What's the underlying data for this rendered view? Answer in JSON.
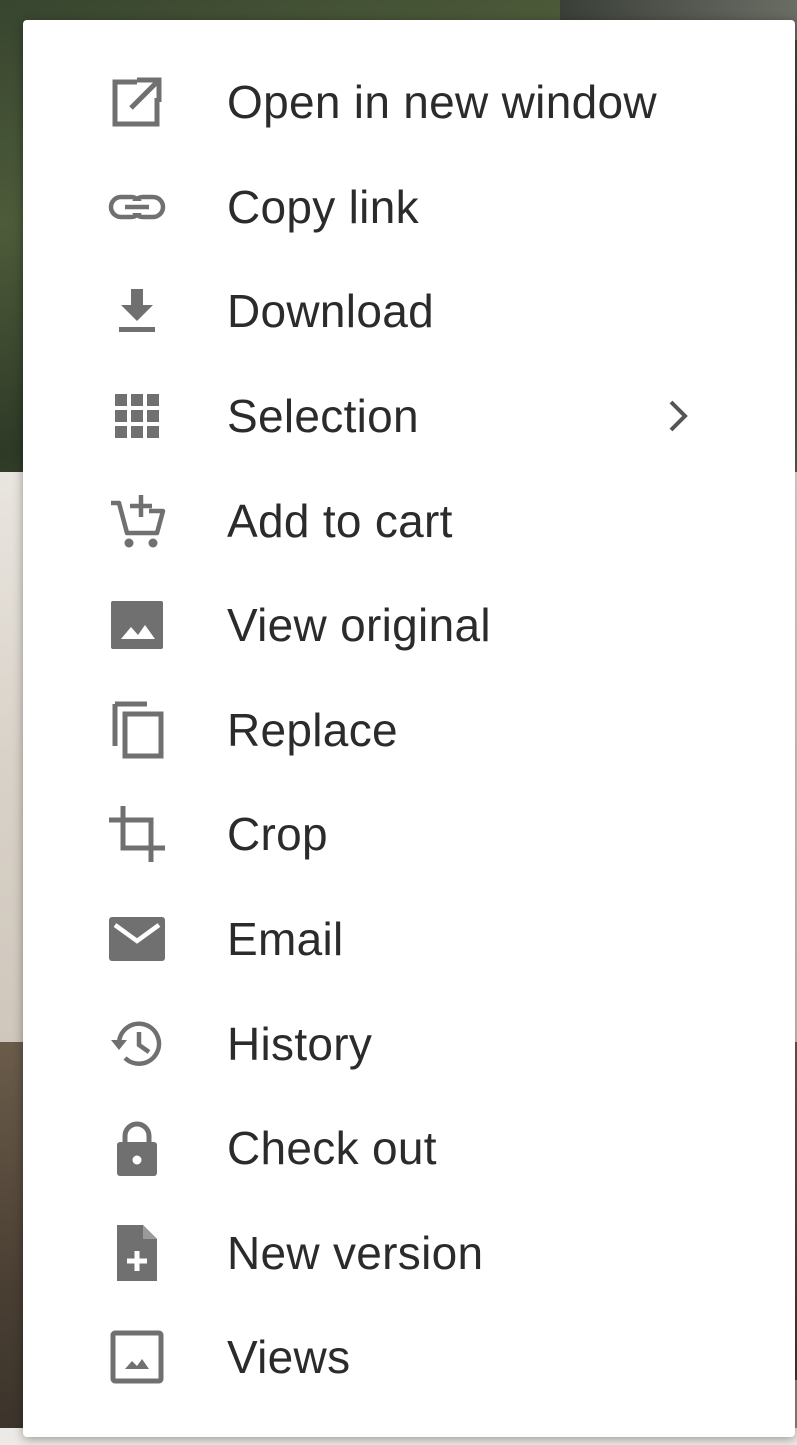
{
  "colors": {
    "icon": "#707070",
    "text": "#2b2b2b",
    "menu_bg": "#ffffff"
  },
  "menu": {
    "items": [
      {
        "label": "Open in new window",
        "icon": "open-in-new-icon"
      },
      {
        "label": "Copy link",
        "icon": "link-icon"
      },
      {
        "label": "Download",
        "icon": "download-icon"
      },
      {
        "label": "Selection",
        "icon": "grid-icon",
        "has_submenu": true
      },
      {
        "label": "Add to cart",
        "icon": "add-to-cart-icon"
      },
      {
        "label": "View original",
        "icon": "image-icon"
      },
      {
        "label": "Replace",
        "icon": "copy-icon"
      },
      {
        "label": "Crop",
        "icon": "crop-icon"
      },
      {
        "label": "Email",
        "icon": "mail-icon"
      },
      {
        "label": "History",
        "icon": "history-icon"
      },
      {
        "label": "Check out",
        "icon": "lock-icon"
      },
      {
        "label": "New version",
        "icon": "file-add-icon"
      },
      {
        "label": "Views",
        "icon": "image-outline-icon"
      }
    ]
  }
}
